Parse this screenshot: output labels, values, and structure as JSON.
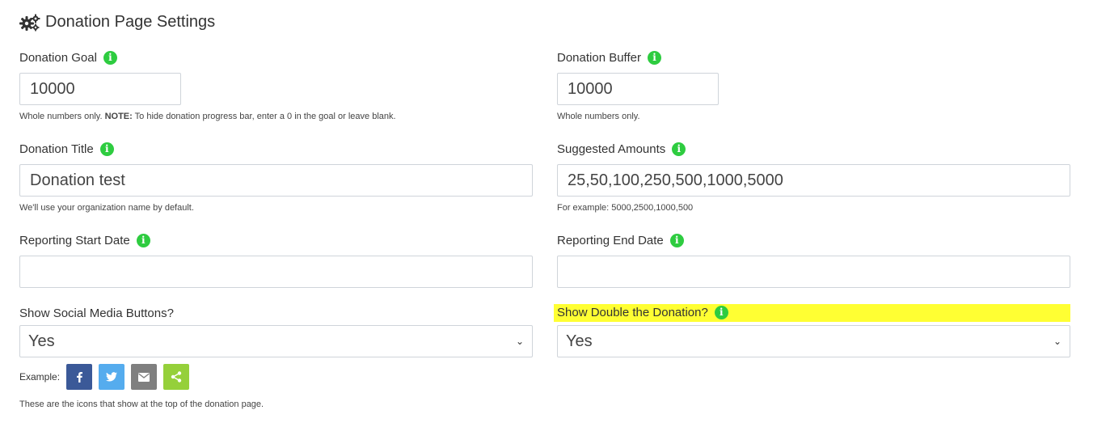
{
  "header": {
    "title": "Donation Page Settings",
    "icon": "gears-icon"
  },
  "fields": {
    "donation_goal": {
      "label": "Donation Goal",
      "value": "10000",
      "help_prefix": "Whole numbers only. ",
      "help_bold": "NOTE:",
      "help_suffix": " To hide donation progress bar, enter a 0 in the goal or leave blank."
    },
    "donation_buffer": {
      "label": "Donation Buffer",
      "value": "10000",
      "help": "Whole numbers only."
    },
    "donation_title": {
      "label": "Donation Title",
      "value": "Donation test",
      "help": "We'll use your organization name by default."
    },
    "suggested_amounts": {
      "label": "Suggested Amounts",
      "value": "25,50,100,250,500,1000,5000",
      "help": "For example: 5000,2500,1000,500"
    },
    "reporting_start": {
      "label": "Reporting Start Date",
      "value": ""
    },
    "reporting_end": {
      "label": "Reporting End Date",
      "value": ""
    },
    "social_buttons": {
      "label": "Show Social Media Buttons?",
      "selected": "Yes"
    },
    "double_donation": {
      "label": "Show Double the Donation?",
      "selected": "Yes",
      "highlight_color": "#ffff33"
    }
  },
  "example": {
    "label": "Example:",
    "buttons": [
      {
        "name": "facebook",
        "glyph": "f",
        "color": "#3b5998"
      },
      {
        "name": "twitter",
        "glyph": "t",
        "color": "#55acee"
      },
      {
        "name": "email",
        "glyph": "✉",
        "color": "#7f7f7f"
      },
      {
        "name": "share",
        "glyph": "<",
        "color": "#95d03a"
      }
    ],
    "help": "These are the icons that show at the top of the donation page."
  },
  "colors": {
    "info_icon": "#2ecc40",
    "border": "#cfd4da"
  }
}
